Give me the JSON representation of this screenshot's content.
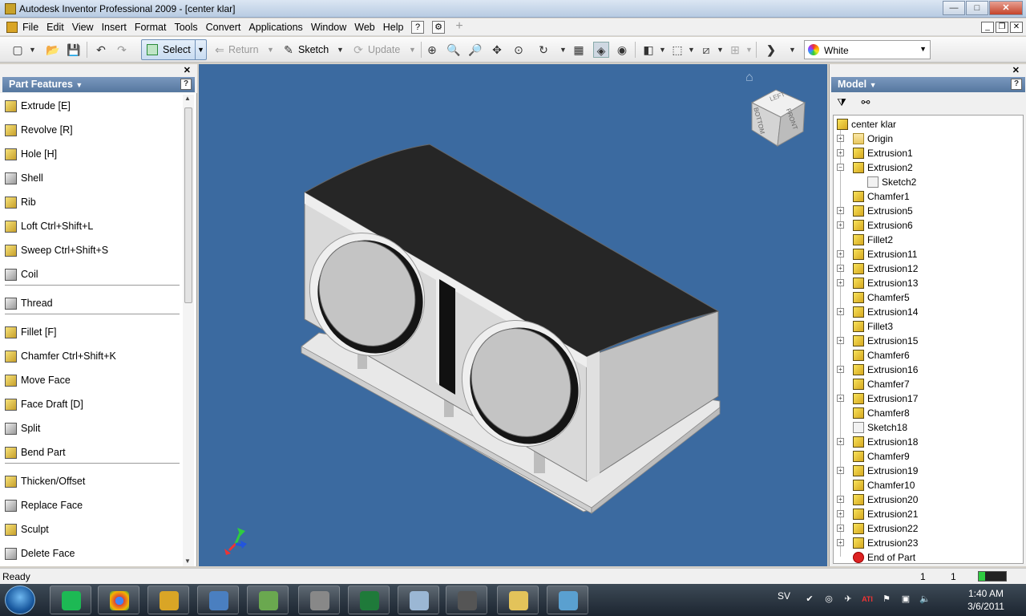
{
  "window": {
    "title": "Autodesk Inventor Professional 2009 - [center klar]",
    "controls": {
      "minimize": "—",
      "maximize": "□",
      "close": "✕"
    }
  },
  "menubar": {
    "items": [
      "File",
      "Edit",
      "View",
      "Insert",
      "Format",
      "Tools",
      "Convert",
      "Applications",
      "Window",
      "Web",
      "Help"
    ],
    "help_icons": [
      "?",
      "⚙",
      "+"
    ],
    "doc_controls": [
      "_",
      "❐",
      "✕"
    ]
  },
  "toolbar": {
    "select_label": "Select",
    "return_label": "Return",
    "sketch_label": "Sketch",
    "update_label": "Update",
    "color_value": "White"
  },
  "left_panel": {
    "title": "Part Features",
    "help": "?",
    "close": "✕",
    "groups": [
      [
        {
          "label": "Extrude   [E]",
          "icon": "extrude-icon"
        },
        {
          "label": "Revolve   [R]",
          "icon": "revolve-icon"
        },
        {
          "label": "Hole    [H]",
          "icon": "hole-icon"
        },
        {
          "label": "Shell",
          "icon": "shell-icon"
        },
        {
          "label": "Rib",
          "icon": "rib-icon"
        },
        {
          "label": "Loft    Ctrl+Shift+L",
          "icon": "loft-icon"
        },
        {
          "label": "Sweep    Ctrl+Shift+S",
          "icon": "sweep-icon"
        },
        {
          "label": "Coil",
          "icon": "coil-icon"
        }
      ],
      [
        {
          "label": "Thread",
          "icon": "thread-icon"
        }
      ],
      [
        {
          "label": "Fillet    [F]",
          "icon": "fillet-icon"
        },
        {
          "label": "Chamfer    Ctrl+Shift+K",
          "icon": "chamfer-icon"
        },
        {
          "label": "Move Face",
          "icon": "move-face-icon"
        },
        {
          "label": "Face Draft    [D]",
          "icon": "face-draft-icon"
        },
        {
          "label": "Split",
          "icon": "split-icon"
        },
        {
          "label": "Bend Part",
          "icon": "bend-part-icon"
        }
      ],
      [
        {
          "label": "Thicken/Offset",
          "icon": "thicken-offset-icon"
        },
        {
          "label": "Replace Face",
          "icon": "replace-face-icon"
        },
        {
          "label": "Sculpt",
          "icon": "sculpt-icon"
        },
        {
          "label": "Delete Face",
          "icon": "delete-face-icon"
        }
      ]
    ]
  },
  "viewport": {
    "viewcube_faces": [
      "LEFT",
      "FRONT",
      "BOTTOM"
    ],
    "colors": {
      "background": "#3b6aa0",
      "top_face": "#262626",
      "body": "#d8d8d8"
    }
  },
  "model_browser": {
    "title": "Model",
    "help": "?",
    "close": "✕",
    "root": "center klar",
    "nodes": [
      {
        "label": "Origin",
        "type": "folder",
        "expandable": true
      },
      {
        "label": "Extrusion1",
        "type": "feature",
        "expandable": true
      },
      {
        "label": "Extrusion2",
        "type": "feature",
        "expandable": true,
        "expanded": true
      },
      {
        "label": "Sketch2",
        "type": "sketch",
        "child": true
      },
      {
        "label": "Chamfer1",
        "type": "feature"
      },
      {
        "label": "Extrusion5",
        "type": "feature",
        "expandable": true
      },
      {
        "label": "Extrusion6",
        "type": "feature",
        "expandable": true
      },
      {
        "label": "Fillet2",
        "type": "feature"
      },
      {
        "label": "Extrusion11",
        "type": "feature",
        "expandable": true
      },
      {
        "label": "Extrusion12",
        "type": "feature",
        "expandable": true
      },
      {
        "label": "Extrusion13",
        "type": "feature",
        "expandable": true
      },
      {
        "label": "Chamfer5",
        "type": "feature"
      },
      {
        "label": "Extrusion14",
        "type": "feature",
        "expandable": true
      },
      {
        "label": "Fillet3",
        "type": "feature"
      },
      {
        "label": "Extrusion15",
        "type": "feature",
        "expandable": true
      },
      {
        "label": "Chamfer6",
        "type": "feature"
      },
      {
        "label": "Extrusion16",
        "type": "feature",
        "expandable": true
      },
      {
        "label": "Chamfer7",
        "type": "feature"
      },
      {
        "label": "Extrusion17",
        "type": "feature",
        "expandable": true
      },
      {
        "label": "Chamfer8",
        "type": "feature"
      },
      {
        "label": "Sketch18",
        "type": "sketch"
      },
      {
        "label": "Extrusion18",
        "type": "feature",
        "expandable": true
      },
      {
        "label": "Chamfer9",
        "type": "feature"
      },
      {
        "label": "Extrusion19",
        "type": "feature",
        "expandable": true
      },
      {
        "label": "Chamfer10",
        "type": "feature"
      },
      {
        "label": "Extrusion20",
        "type": "feature",
        "expandable": true
      },
      {
        "label": "Extrusion21",
        "type": "feature",
        "expandable": true
      },
      {
        "label": "Extrusion22",
        "type": "feature",
        "expandable": true
      },
      {
        "label": "Extrusion23",
        "type": "feature",
        "expandable": true
      },
      {
        "label": "End of Part",
        "type": "end"
      }
    ]
  },
  "statusbar": {
    "status": "Ready",
    "count1": "1",
    "count2": "1"
  },
  "taskbar": {
    "apps": [
      "spotify-icon",
      "chrome-icon",
      "inventor-icon",
      "remote-desktop-icon",
      "network-icon",
      "disc-icon",
      "excel-icon",
      "calculator-icon",
      "phone-icon",
      "folder-icon",
      "picture-icon"
    ],
    "language": "SV",
    "time": "1:40 AM",
    "date": "3/6/2011"
  }
}
